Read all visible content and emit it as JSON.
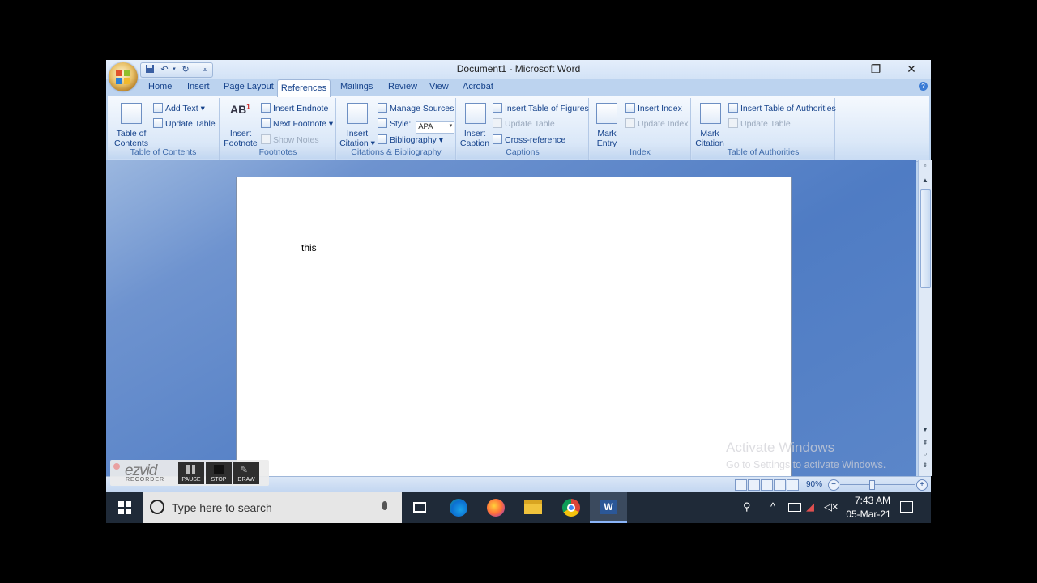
{
  "window": {
    "title": "Document1 - Microsoft Word",
    "minimize": "—",
    "maximize": "❐",
    "close": "✕"
  },
  "tabs": [
    "Home",
    "Insert",
    "Page Layout",
    "References",
    "Mailings",
    "Review",
    "View",
    "Acrobat"
  ],
  "ribbon": {
    "toc": {
      "big_label_1": "Table of",
      "big_label_2": "Contents ▾",
      "add_text": "Add Text ▾",
      "update_table": "Update Table",
      "group": "Table of Contents"
    },
    "footnotes": {
      "ab": "AB",
      "sup": "1",
      "big_label_1": "Insert",
      "big_label_2": "Footnote",
      "insert_endnote": "Insert Endnote",
      "next_footnote": "Next Footnote ▾",
      "show_notes": "Show Notes",
      "group": "Footnotes"
    },
    "citations": {
      "big_label_1": "Insert",
      "big_label_2": "Citation ▾",
      "manage_sources": "Manage Sources",
      "style_label": "Style:",
      "style_value": "APA",
      "bibliography": "Bibliography ▾",
      "group": "Citations & Bibliography"
    },
    "captions": {
      "big_label_1": "Insert",
      "big_label_2": "Caption",
      "insert_tof": "Insert Table of Figures",
      "update_table": "Update Table",
      "cross_reference": "Cross-reference",
      "group": "Captions"
    },
    "index": {
      "big_label_1": "Mark",
      "big_label_2": "Entry",
      "insert_index": "Insert Index",
      "update_index": "Update Index",
      "group": "Index"
    },
    "authorities": {
      "big_label_1": "Mark",
      "big_label_2": "Citation",
      "insert_toa": "Insert Table of Authorities",
      "update_table": "Update Table",
      "group": "Table of Authorities"
    }
  },
  "document": {
    "text": "this"
  },
  "statusbar": {
    "zoom": "90%"
  },
  "watermark": {
    "line1": "Activate Windows",
    "line2": "Go to Settings to activate Windows."
  },
  "ezvid": {
    "logo": "ezvid",
    "sub": "RECORDER",
    "pause": "PAUSE",
    "stop": "STOP",
    "draw": "DRAW"
  },
  "taskbar": {
    "search_placeholder": "Type here to search",
    "time": "7:43 AM",
    "date": "05-Mar-21"
  },
  "colors": {
    "ribbon_text": "#15428b",
    "taskbar": "#1f2a38",
    "doc_bg": "#4f7cc4"
  }
}
